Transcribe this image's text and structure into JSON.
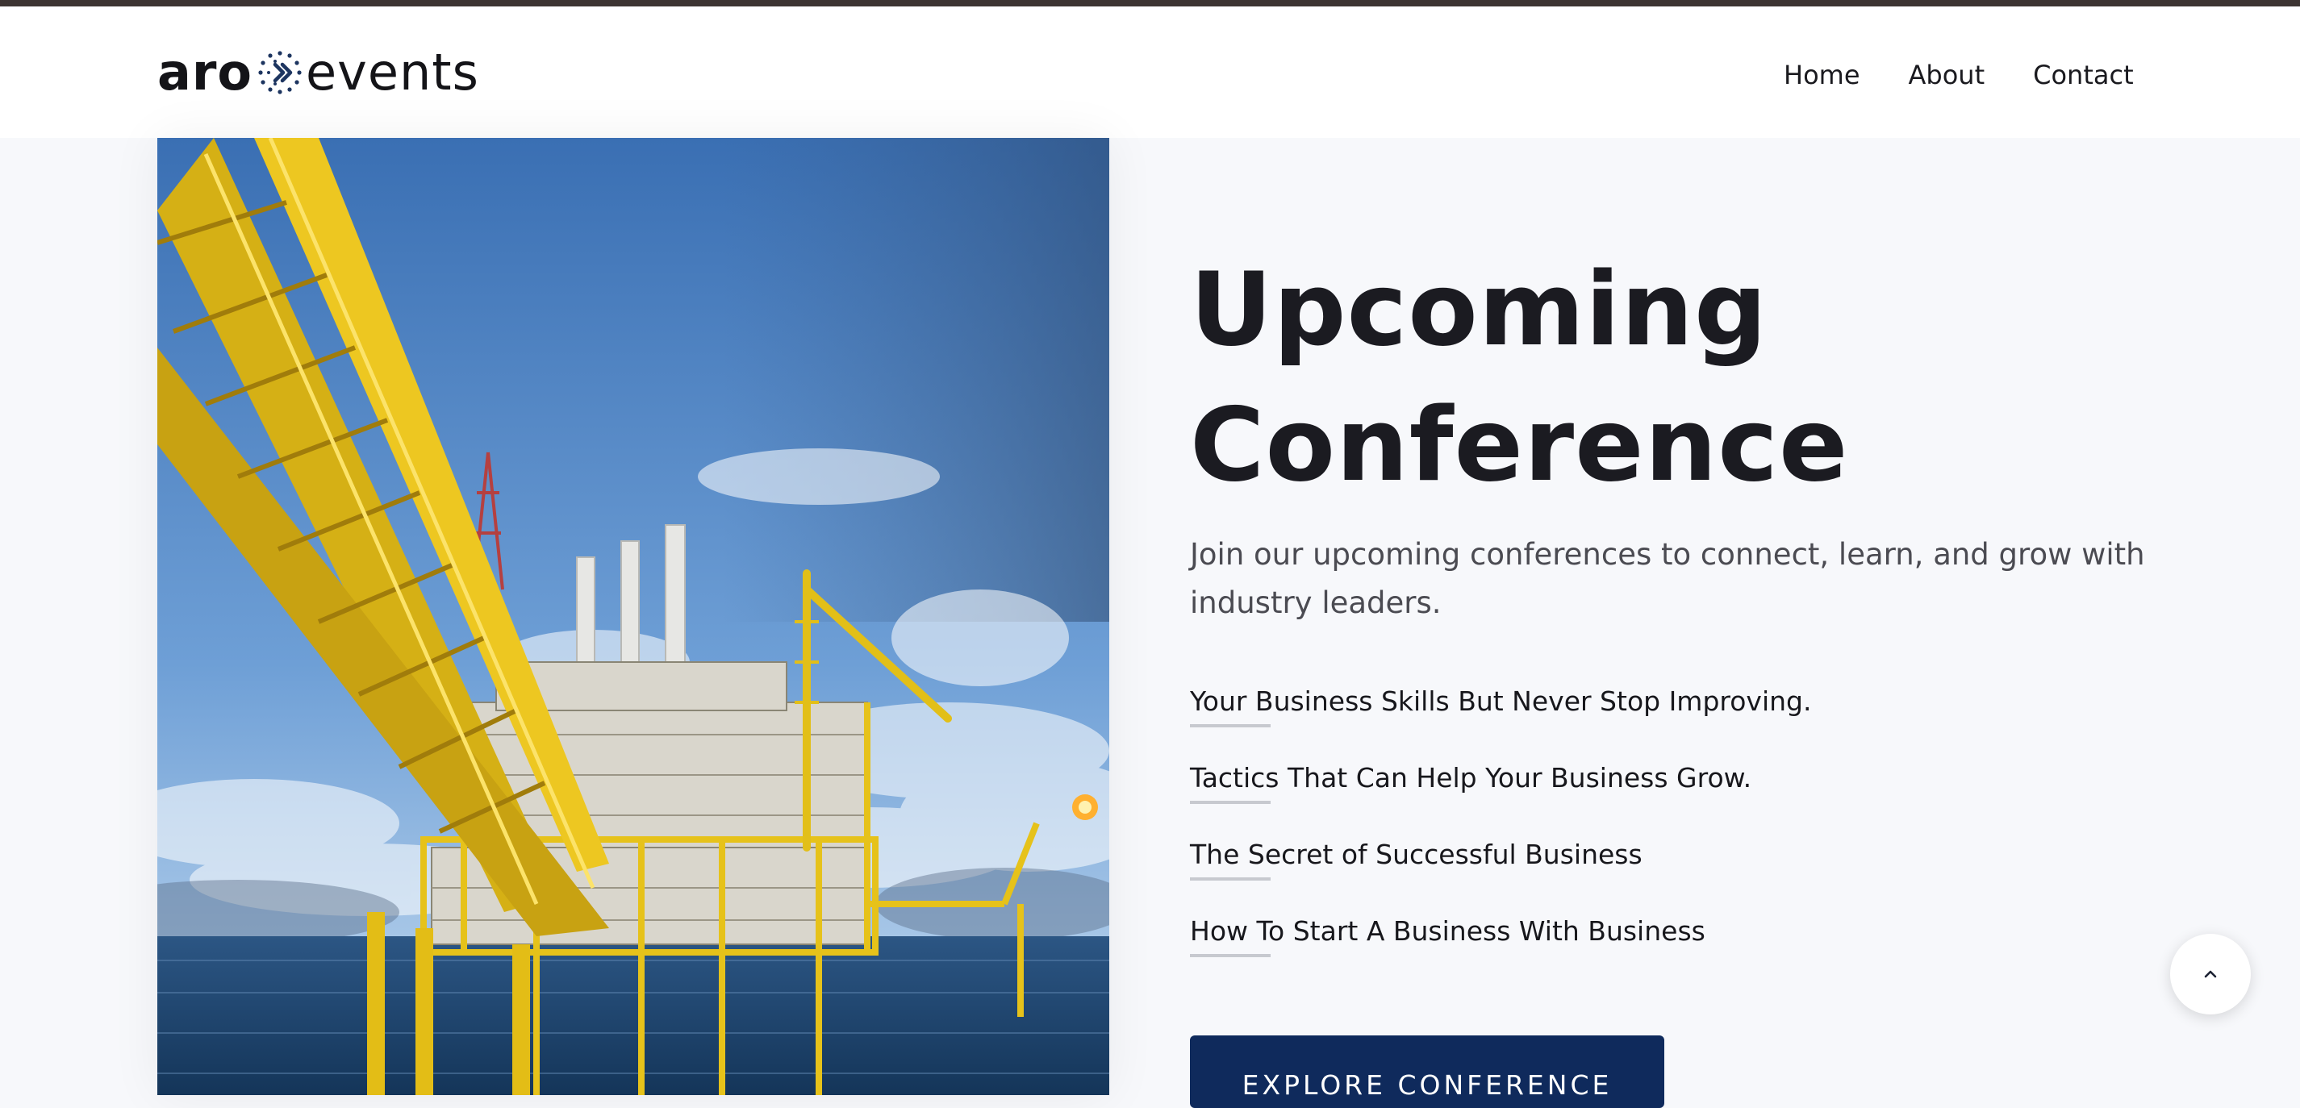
{
  "header": {
    "logo": {
      "part1": "aro",
      "part2": "events"
    },
    "nav": {
      "home": "Home",
      "about": "About",
      "contact": "Contact"
    }
  },
  "hero": {
    "title_line1": "Upcoming",
    "title_line2": "Conference",
    "subtitle": "Join our upcoming conferences to connect, learn, and grow with industry leaders.",
    "topics": [
      "Your Business Skills But Never Stop Improving.",
      "Tactics That Can Help Your Business Grow.",
      "The Secret of Successful Business",
      "How To Start A Business With Business"
    ],
    "cta_label": "EXPLORE CONFERENCE"
  },
  "icons": {
    "logo_mark": "chevron-dots-icon",
    "scroll_top": "chevron-up-icon"
  },
  "colors": {
    "topbar": "#3d3432",
    "background": "#f7f8fb",
    "cta": "#0f2a5c",
    "heading": "#1b1b21",
    "body_text": "#4b4b52"
  }
}
